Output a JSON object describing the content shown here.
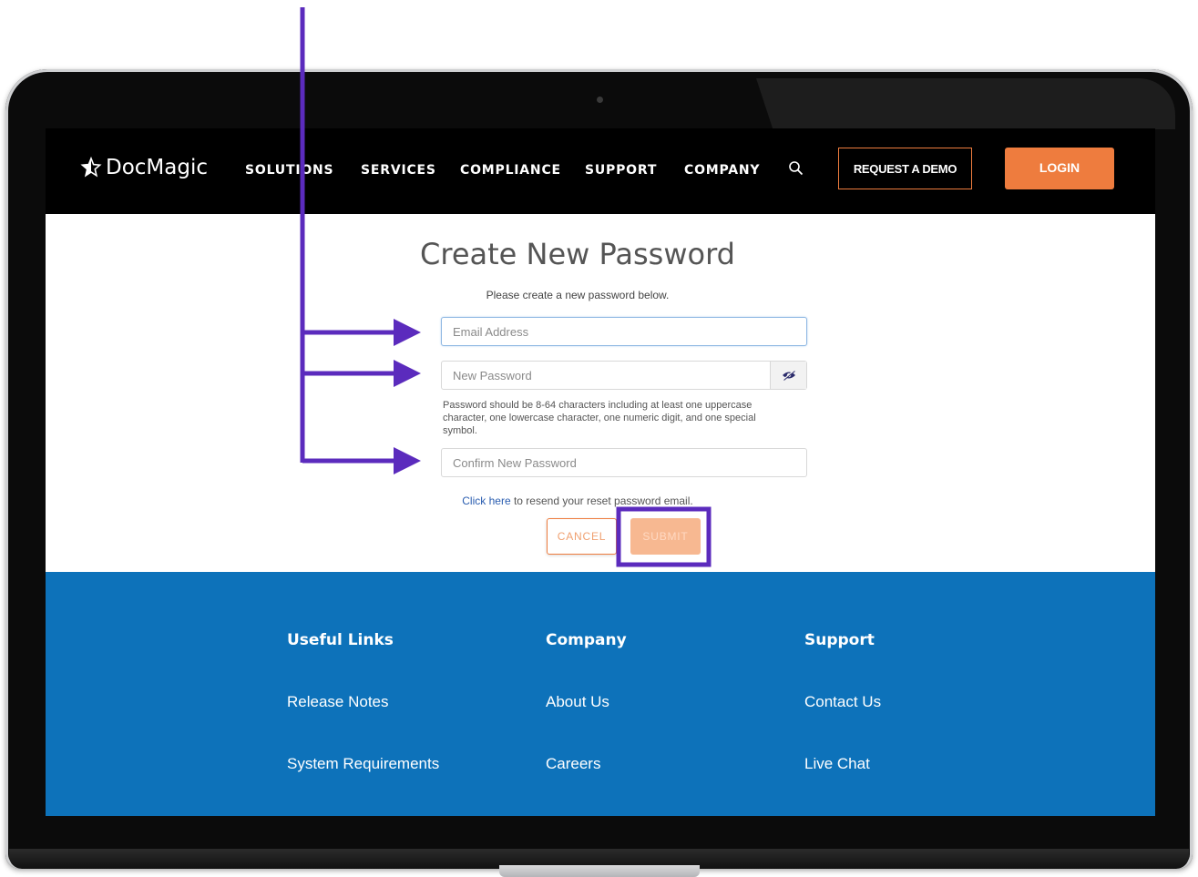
{
  "brand": {
    "name": "DocMagic"
  },
  "nav": {
    "links": [
      "SOLUTIONS",
      "SERVICES",
      "COMPLIANCE",
      "SUPPORT",
      "COMPANY"
    ],
    "demo_label": "REQUEST A DEMO",
    "login_label": "LOGIN"
  },
  "form": {
    "title": "Create New Password",
    "subtitle": "Please create a new password below.",
    "email_placeholder": "Email Address",
    "new_password_placeholder": "New Password",
    "password_hint": "Password should be 8-64 characters including at least one uppercase character, one lowercase character, one numeric digit, and one special symbol.",
    "confirm_placeholder": "Confirm New Password",
    "resend_link": "Click here",
    "resend_text": " to resend your reset password email.",
    "cancel_label": "CANCEL",
    "submit_label": "SUBMIT"
  },
  "footer": {
    "columns": [
      {
        "heading": "Useful Links",
        "links": [
          "Release Notes",
          "System Requirements"
        ]
      },
      {
        "heading": "Company",
        "links": [
          "About Us",
          "Careers"
        ]
      },
      {
        "heading": "Support",
        "links": [
          "Contact Us",
          "Live Chat"
        ]
      }
    ]
  },
  "colors": {
    "accent_orange": "#ee7c3e",
    "footer_blue": "#0d72ba",
    "annotation_purple": "#5b2bbd"
  },
  "icons": {
    "logo": "star-icon",
    "search": "search-icon",
    "eye_toggle": "eye-slash-icon"
  }
}
